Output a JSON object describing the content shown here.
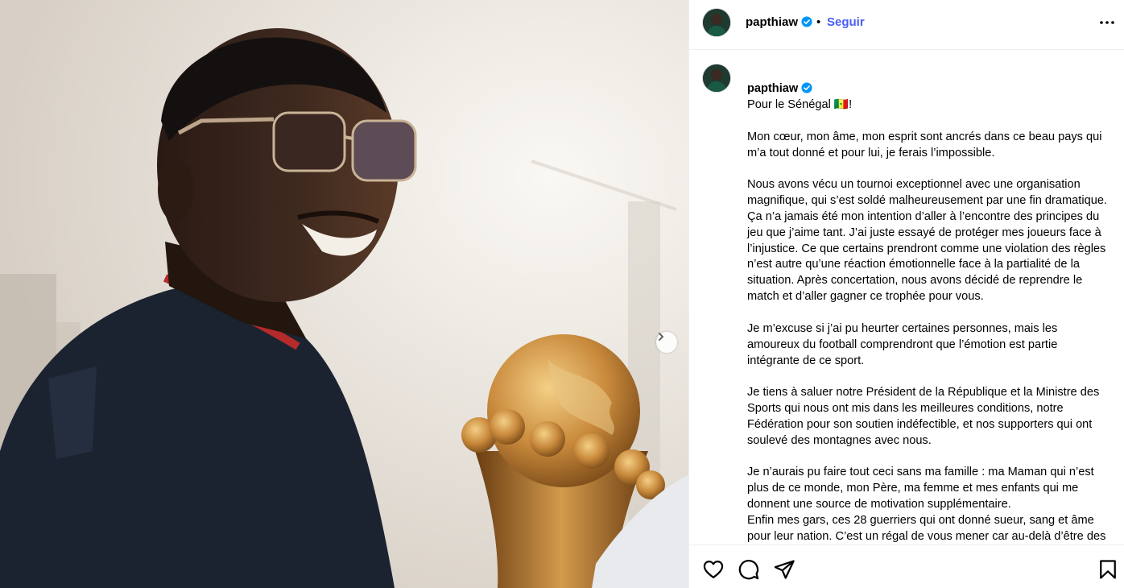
{
  "post": {
    "author": "papthiaw",
    "follow_label": "Seguir",
    "separator": "•",
    "caption_title": "Pour le Sénégal 🇸🇳!",
    "caption_paragraphs": [
      "Mon cœur, mon âme, mon esprit sont ancrés dans ce beau pays qui m’a tout donné et pour lui, je ferais l’impossible.",
      "Nous avons vécu un tournoi exceptionnel avec une organisation magnifique, qui s’est soldé malheureusement par une fin dramatique. Ça n’a jamais été mon intention d’aller à l’encontre des principes du jeu que j’aime tant. J’ai juste essayé de protéger mes joueurs face à l’injustice. Ce que certains prendront comme une violation des règles n’est autre qu’une réaction émotionnelle face à la partialité de la situation. Après concertation, nous avons décidé de reprendre le match et d’aller gagner ce trophée pour vous.",
      "Je m’excuse si j’ai pu heurter certaines personnes, mais les amoureux du football comprendront que l’émotion est partie intégrante de ce sport.",
      "Je tiens à saluer notre Président de la République et la Ministre des Sports qui nous ont mis dans les meilleures conditions, notre Fédération pour son soutien indéfectible, et nos supporters qui ont soulevé des montagnes avec nous.",
      "Je n’aurais pu faire tout ceci sans ma famille : ma Maman qui n’est plus de ce monde, mon Père, ma femme et mes enfants qui me donnent une source de motivation supplémentaire.\nEnfin mes gars, ces 28 guerriers qui ont donné sueur, sang et âme pour leur nation. C’est un régal de vous mener car au-delà d’être des légendes, vous êtes des personnes exceptionnelles !"
    ]
  },
  "icons": {
    "verified": "verified-badge-icon",
    "more": "more-options-icon",
    "next": "chevron-right-icon",
    "like": "heart-icon",
    "comment": "comment-bubble-icon",
    "share": "paper-plane-icon",
    "save": "bookmark-icon"
  },
  "colors": {
    "accent": "#4a5df9",
    "verified": "#0095f6",
    "border": "#efefef"
  }
}
